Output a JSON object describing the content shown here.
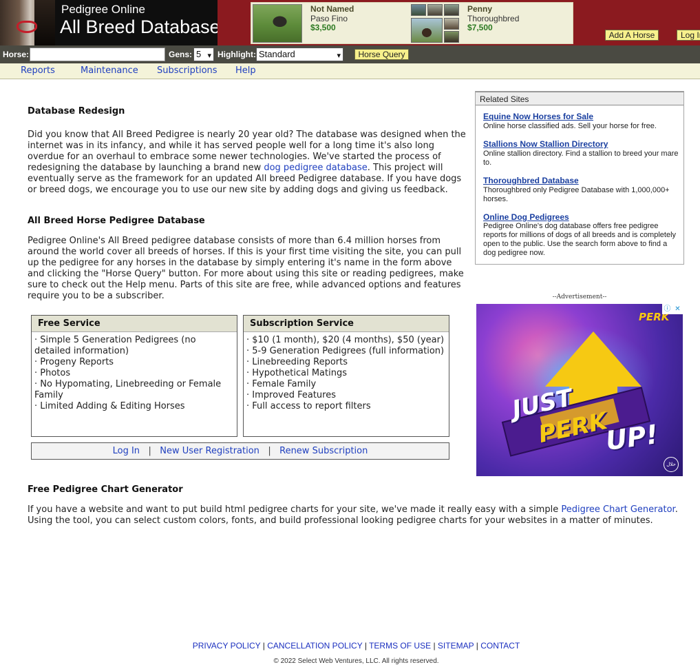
{
  "header": {
    "logo_subtitle": "Pedigree Online",
    "logo_title": "All Breed Database",
    "featured": [
      {
        "name": "Not Named",
        "breed": "Paso Fino",
        "price": "$3,500"
      },
      {
        "name": "Penny",
        "breed": "Thoroughbred",
        "price": "$7,500"
      }
    ],
    "add_horse_label": "Add A Horse",
    "login_label": "Log In"
  },
  "query": {
    "horse_label": "Horse:",
    "horse_value": "",
    "gens_label": "Gens:",
    "gens_value": "5",
    "highlight_label": "Highlight:",
    "highlight_value": "Standard",
    "button_label": "Horse Query"
  },
  "nav": {
    "items": [
      {
        "label": "Reports"
      },
      {
        "label": "Maintenance"
      },
      {
        "label": "Subscriptions"
      },
      {
        "label": "Help"
      }
    ]
  },
  "main": {
    "redesign_heading": "Database Redesign",
    "redesign_p1": "Did you know that All Breed Pedigree is nearly 20 year old? The database was designed when the internet was in its infancy, and while it has served people well for a long time it's also long overdue for an overhaul to embrace some newer technologies. We've started the process of redesigning the database by launching a brand new ",
    "redesign_link": "dog pedigree database",
    "redesign_p2": ". This project will eventually serve as the framework for an updated All breed Pedigree database. If you have dogs or breed dogs, we encourage you to use our new site by adding dogs and giving us feedback.",
    "allbreed_heading": "All Breed Horse Pedigree Database",
    "allbreed_text": "Pedigree Online's All Breed pedigree database consists of more than 6.4 million horses from around the world cover all breeds of horses. If this is your first time visiting the site, you can pull up the pedigree for any horses in the database by simply entering it's name in the form above and clicking the \"Horse Query\" button. For more about using this site or reading pedigrees, make sure to check out the Help menu. Parts of this site are free, while advanced options and features require you to be a subscriber.",
    "free_service": {
      "title": "Free Service",
      "items": [
        "· Simple 5 Generation Pedigrees (no detailed information)",
        "· Progeny Reports",
        "· Photos",
        "· No Hypomating, Linebreeding or Female Family",
        "· Limited Adding & Editing Horses"
      ]
    },
    "subscription_service": {
      "title": "Subscription Service",
      "items": [
        "· $10 (1 month), $20 (4 months), $50 (year)",
        "· 5-9 Generation Pedigrees (full information)",
        "· Linebreeding Reports",
        "· Hypothetical Matings",
        "· Female Family",
        "· Improved Features",
        "· Full access to report filters"
      ]
    },
    "account_links": {
      "login": "Log In",
      "register": "New User Registration",
      "renew": "Renew Subscription",
      "separator": "|"
    },
    "chart_heading": "Free Pedigree Chart Generator",
    "chart_p1": "If you have a website and want to put build html pedigree charts for your site, we've made it really easy with a simple ",
    "chart_link": "Pedigree Chart Generator",
    "chart_p2": ". Using the tool, you can select custom colors, fonts, and build professional looking pedigree charts for your websites in a matter of minutes."
  },
  "related": {
    "title": "Related Sites",
    "items": [
      {
        "link": "Equine Now Horses for Sale",
        "desc": "Online horse classified ads. Sell your horse for free."
      },
      {
        "link": "Stallions Now Stallion Directory",
        "desc": "Online stallion directory. Find a stallion to breed your mare to."
      },
      {
        "link": "Thoroughbred Database",
        "desc": "Thoroughbred only Pedigree Database with 1,000,000+ horses."
      },
      {
        "link": "Online Dog Pedigrees",
        "desc": "Pedigree Online's dog database offers free pedigree reports for millions of dogs of all breeds and is completely open to the public. Use the search form above to find a dog pedigree now."
      }
    ]
  },
  "ad": {
    "label": "--Advertisement--",
    "brand": "PERK",
    "line1": "JUST",
    "line2": "PERK",
    "line3": "UP!"
  },
  "footer": {
    "links": [
      "PRIVACY POLICY",
      "CANCELLATION POLICY",
      "TERMS OF USE",
      "SITEMAP",
      "CONTACT"
    ],
    "separator": "|",
    "copyright": "© 2022 Select Web Ventures, LLC. All rights reserved."
  },
  "colors": {
    "header_red": "#8b1a1f",
    "query_bar": "#4a4a42",
    "nav_bg": "#f4f3d9",
    "link_blue": "#1f3fbf",
    "button_yellow": "#f7f08c"
  }
}
